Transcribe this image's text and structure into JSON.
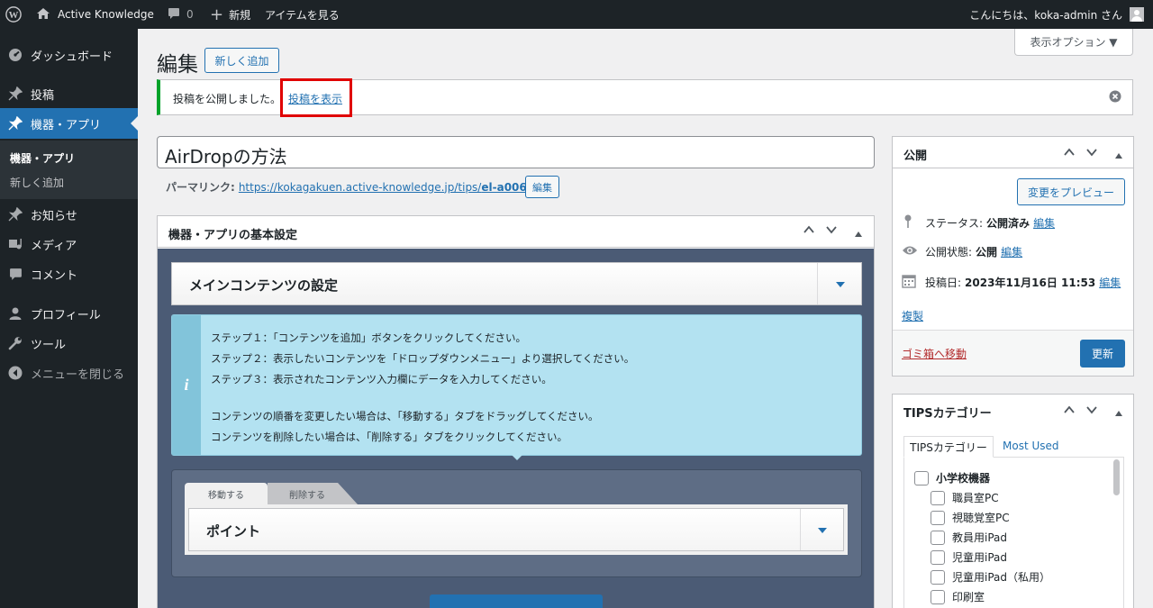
{
  "adminbar": {
    "site_name": "Active Knowledge",
    "comments_count": "0",
    "new_label": "新規",
    "view_item": "アイテムを見る",
    "greeting": "こんにちは、koka-admin さん"
  },
  "sidebar": {
    "items": [
      {
        "label": "ダッシュボード"
      },
      {
        "label": "投稿"
      },
      {
        "label": "機器・アプリ"
      },
      {
        "label": "お知らせ"
      },
      {
        "label": "メディア"
      },
      {
        "label": "コメント"
      },
      {
        "label": "プロフィール"
      },
      {
        "label": "ツール"
      },
      {
        "label": "メニューを閉じる"
      }
    ],
    "submenu": {
      "current": "機器・アプリ",
      "add_new": "新しく追加"
    }
  },
  "screen_options": "表示オプション ▼",
  "header": {
    "title": "編集",
    "add_new": "新しく追加"
  },
  "notice": {
    "text": "投稿を公開しました。",
    "link": "投稿を表示"
  },
  "post": {
    "title": "AirDropの方法",
    "permalink_label": "パーマリンク:",
    "permalink_base": "https://kokagakuen.active-knowledge.jp/tips/",
    "permalink_slug": "el-a006",
    "permalink_end": "/",
    "permalink_edit": "編集"
  },
  "metabox_basic": {
    "title": "機器・アプリの基本設定",
    "main_content_header": "メインコンテンツの設定",
    "info_lines": [
      "ステップ１：「コンテンツを追加」ボタンをクリックしてください。",
      "ステップ２：表示したいコンテンツを「ドロップダウンメニュー」より選択してください。",
      "ステップ３：表示されたコンテンツ入力欄にデータを入力してください。",
      "コンテンツの順番を変更したい場合は、「移動する」タブをドラッグしてください。",
      "コンテンツを削除したい場合は、「削除する」タブをクリックしてください。"
    ],
    "tab_move": "移動する",
    "tab_delete": "削除する",
    "point_header": "ポイント"
  },
  "publish": {
    "title": "公開",
    "preview": "変更をプレビュー",
    "status_label": "ステータス:",
    "status_value": "公開済み",
    "visibility_label": "公開状態:",
    "visibility_value": "公開",
    "date_label": "投稿日:",
    "date_value": "2023年11月16日 11:53",
    "edit": "編集",
    "duplicate": "複製",
    "trash": "ゴミ箱へ移動",
    "update": "更新"
  },
  "tips": {
    "title": "TIPSカテゴリー",
    "tab_all": "TIPSカテゴリー",
    "tab_used": "Most Used",
    "categories": [
      {
        "label": "小学校機器",
        "bold": true
      },
      {
        "label": "職員室PC"
      },
      {
        "label": "視聴覚室PC"
      },
      {
        "label": "教員用iPad"
      },
      {
        "label": "児童用iPad"
      },
      {
        "label": "児童用iPad（私用）"
      },
      {
        "label": "印刷室"
      }
    ]
  },
  "colors": {
    "accent": "#2271b1",
    "sidebar": "#1d2327",
    "notice_border": "#00a32a",
    "highlight": "#e00000",
    "info_bg": "#b0e0f0",
    "trash": "#b32d2e"
  }
}
